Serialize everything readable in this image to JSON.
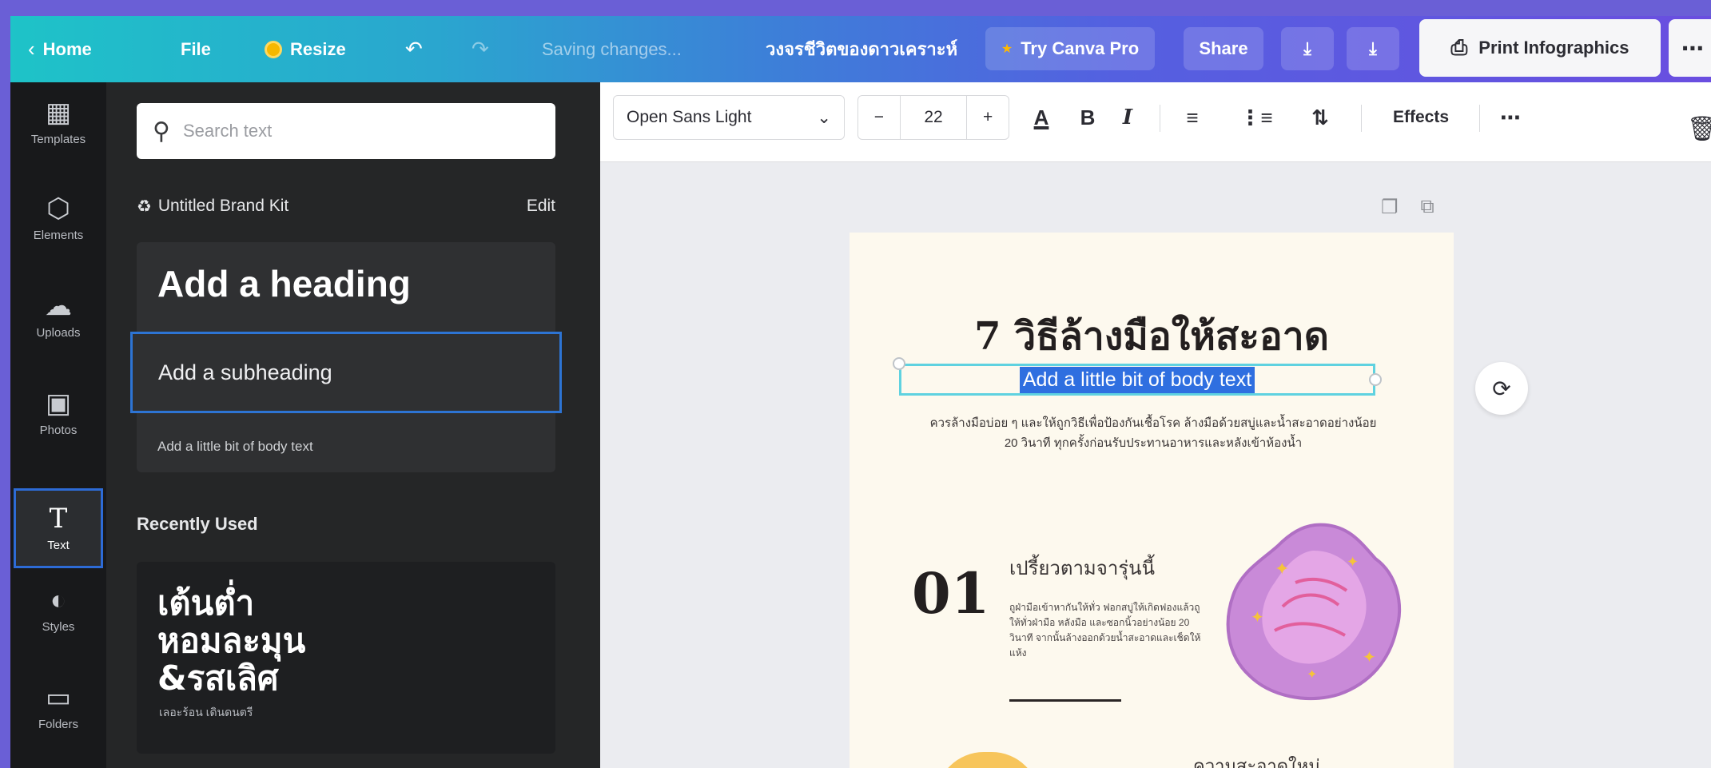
{
  "topbar": {
    "home": "Home",
    "file": "File",
    "resize": "Resize",
    "saving": "Saving changes...",
    "doc_title": "วงจรชีวิตของดาวเคราะห์",
    "try_pro": "Try Canva Pro",
    "share": "Share",
    "print": "Print Infographics",
    "more": "⋯"
  },
  "rail": {
    "items": [
      {
        "label": "Templates",
        "icon": "▦"
      },
      {
        "label": "Elements",
        "icon": "⬡"
      },
      {
        "label": "Uploads",
        "icon": "☁"
      },
      {
        "label": "Photos",
        "icon": "▣"
      },
      {
        "label": "Text",
        "icon": "T"
      },
      {
        "label": "Styles",
        "icon": "◐"
      },
      {
        "label": "Folders",
        "icon": "▭"
      }
    ]
  },
  "panel": {
    "search_placeholder": "Search text",
    "brand_kit": "Untitled Brand Kit",
    "edit": "Edit",
    "add_heading": "Add a heading",
    "add_subheading": "Add a subheading",
    "add_body": "Add a little bit of body text",
    "recently_used": "Recently Used",
    "recent_big_1": "เต้นต่ำ",
    "recent_big_2": "หอมละมุน",
    "recent_big_3": "&รสเลิศ",
    "recent_small": "เลอะร้อน เดินดนตรี"
  },
  "toolbar": {
    "font": "Open Sans Light",
    "minus": "−",
    "size": "22",
    "plus": "+",
    "effects": "Effects",
    "more": "⋯"
  },
  "canvas": {
    "title": "7 วิธีล้างมือให้สะอาด",
    "subtitle": "Add a little bit of body text",
    "body": "ควรล้างมือบ่อย ๆ และให้ถูกวิธีเพื่อป้องกันเชื้อโรค ล้างมือด้วยสบู่และน้ำสะอาดอย่างน้อย 20 วินาที ทุกครั้งก่อนรับประทานอาหารและหลังเข้าห้องน้ำ",
    "step_number": "01",
    "step_title": "เปรี้ยวตามจารุ่นนี้",
    "step_text": "ถูฝ่ามือเข้าหากันให้ทั่ว ฟอกสบู่ให้เกิดฟองแล้วถูให้ทั่วฝ่ามือ หลังมือ และซอกนิ้วอย่างน้อย 20 วินาที จากนั้นล้างออกด้วยน้ำสะอาดและเช็ดให้แห้ง",
    "step2_title": "ความสะอาดใหม่"
  }
}
